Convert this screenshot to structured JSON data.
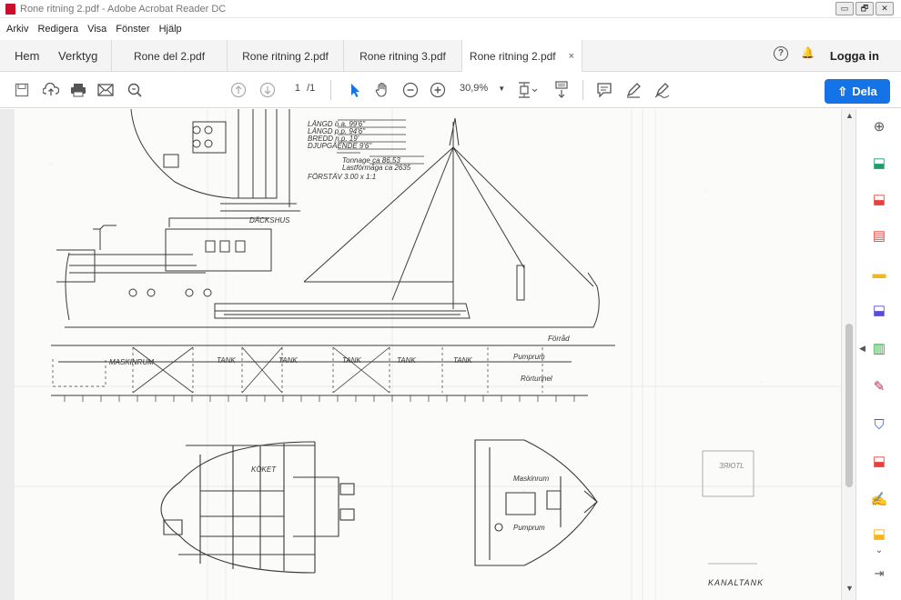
{
  "window": {
    "title": "Rone ritning 2.pdf - Adobe Acrobat Reader DC",
    "controls": [
      "▭",
      "🗗",
      "✕"
    ]
  },
  "menu": [
    "Arkiv",
    "Redigera",
    "Visa",
    "Fönster",
    "Hjälp"
  ],
  "nav": {
    "home": "Hem",
    "tools": "Verktyg"
  },
  "tabs": [
    {
      "label": "Rone del 2.pdf"
    },
    {
      "label": "Rone ritning 2.pdf"
    },
    {
      "label": "Rone ritning 3.pdf"
    },
    {
      "label": "Rone ritning 2.pdf",
      "close": "×"
    }
  ],
  "account": {
    "help": "?",
    "bell": "🔔",
    "login": "Logga in"
  },
  "toolbar": {
    "page_current": "1",
    "page_total": "/1",
    "zoom": "30,9%",
    "share_label": "Dela",
    "share_icon": "⇧"
  },
  "drawing": {
    "spec_lines": [
      "LÄNGD ö.a. 99'6\"",
      "LÄNGD p.p. 94'6\"",
      "BREDD n.p. 19'",
      "DJUPGÅENDE 9'6\"",
      "Tonnage ca 86,53",
      "Lastförmåga ca 2635"
    ],
    "labels": [
      "MASKINRUM",
      "TANK",
      "TANK",
      "TANK",
      "TANK",
      "TANK",
      "Pumprum",
      "Förråd",
      "Rörtunnel",
      "DÄCKSHUS",
      "FÖRSTÄV 3.00 x 1:1",
      "Maskinrum",
      "Pumprum",
      "KANALTANK",
      "KÖKET"
    ],
    "stamp": "ЗЯЮTL"
  },
  "rightpanel_icons": [
    {
      "name": "zoom-search",
      "glyph": "⊕",
      "color": "#555"
    },
    {
      "name": "export-pdf",
      "glyph": "⬓",
      "color": "#1f9e6b"
    },
    {
      "name": "create-pdf",
      "glyph": "⬓",
      "color": "#e8413c"
    },
    {
      "name": "organize-pages",
      "glyph": "▤",
      "color": "#e8413c"
    },
    {
      "name": "comment",
      "glyph": "▬",
      "color": "#f3b71a"
    },
    {
      "name": "combine-files",
      "glyph": "⬓",
      "color": "#5b4bdb"
    },
    {
      "name": "edit-pdf",
      "glyph": "▥",
      "color": "#2f9e3f"
    },
    {
      "name": "fill-sign",
      "glyph": "✎",
      "color": "#c9245a"
    },
    {
      "name": "protect",
      "glyph": "⛉",
      "color": "#3a5ad9"
    },
    {
      "name": "adobe-pdf",
      "glyph": "⬓",
      "color": "#e8413c"
    },
    {
      "name": "send-signature",
      "glyph": "✍",
      "color": "#7a3ab8"
    },
    {
      "name": "more-tools",
      "glyph": "⬓",
      "color": "#f3b71a"
    }
  ]
}
